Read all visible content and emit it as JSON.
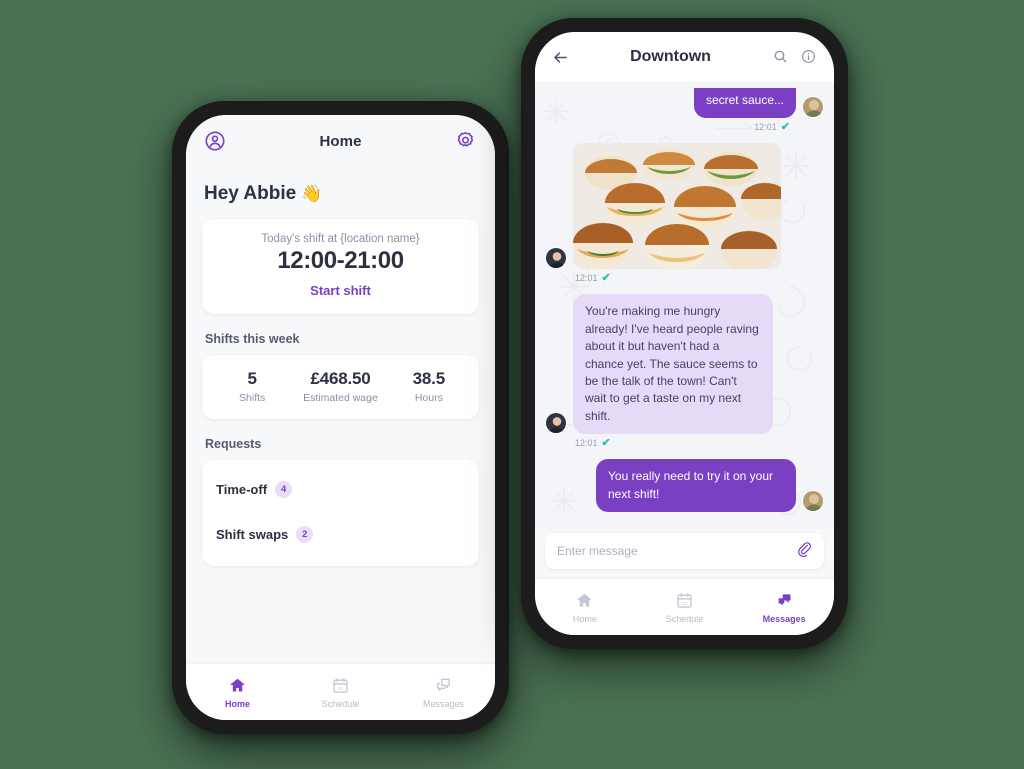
{
  "canvas": {
    "background": "#4a7254"
  },
  "theme": {
    "accent": "#7b40c7",
    "bubble_out": "#7b3fc4",
    "bubble_in": "#e5dbf6",
    "screen_bg": "#f7f8fa",
    "chat_bg": "#f4f5f8",
    "tick_color": "#27c4b0",
    "badge_bg": "#e9ddf8"
  },
  "left_phone": {
    "header": {
      "account_icon": "account-circle-icon",
      "title": "Home",
      "settings_icon": "gear-icon"
    },
    "greeting": {
      "text": "Hey Abbie",
      "emoji": "👋"
    },
    "shift_card": {
      "subtitle": "Today's shift at {location name}",
      "time": "12:00-21:00",
      "action": "Start shift"
    },
    "shifts_section": {
      "label": "Shifts this week",
      "stats": [
        {
          "value": "5",
          "label": "Shifts"
        },
        {
          "value": "£468.50",
          "label": "Estimated wage"
        },
        {
          "value": "38.5",
          "label": "Hours"
        }
      ]
    },
    "requests_section": {
      "label": "Requests",
      "items": [
        {
          "label": "Time-off",
          "badge": "4"
        },
        {
          "label": "Shift swaps",
          "badge": "2"
        }
      ]
    },
    "tabs": [
      {
        "label": "Home",
        "icon": "home-icon",
        "active": true
      },
      {
        "label": "Schedule",
        "icon": "calendar-icon",
        "active": false
      },
      {
        "label": "Messages",
        "icon": "chat-bubbles-icon",
        "active": false
      }
    ]
  },
  "right_phone": {
    "header": {
      "back_icon": "back-arrow-icon",
      "title": "Downtown",
      "search_icon": "search-icon",
      "info_icon": "info-icon"
    },
    "messages": [
      {
        "type": "text",
        "direction": "out",
        "text": "secret sauce...",
        "time": "12:01",
        "status": "read",
        "clipped": true
      },
      {
        "type": "image",
        "direction": "in",
        "alt": "photo of slider sandwiches on a platter",
        "time": "12:01",
        "status": "read"
      },
      {
        "type": "text",
        "direction": "in",
        "text": "You're making me hungry already! I've heard people raving about it but haven't had a chance yet. The sauce seems to be the talk of the town! Can't wait to get a taste on my next shift.",
        "time": "12:01",
        "status": "read"
      },
      {
        "type": "text",
        "direction": "out",
        "text": "You really need to try it on your next shift!",
        "time": "",
        "status": ""
      }
    ],
    "composer": {
      "placeholder": "Enter message",
      "value": "",
      "attach_icon": "paperclip-icon"
    },
    "tabs": [
      {
        "label": "Home",
        "icon": "home-icon",
        "active": false
      },
      {
        "label": "Schedule",
        "icon": "calendar-icon",
        "active": false
      },
      {
        "label": "Messages",
        "icon": "chat-bubbles-icon",
        "active": true
      }
    ]
  }
}
